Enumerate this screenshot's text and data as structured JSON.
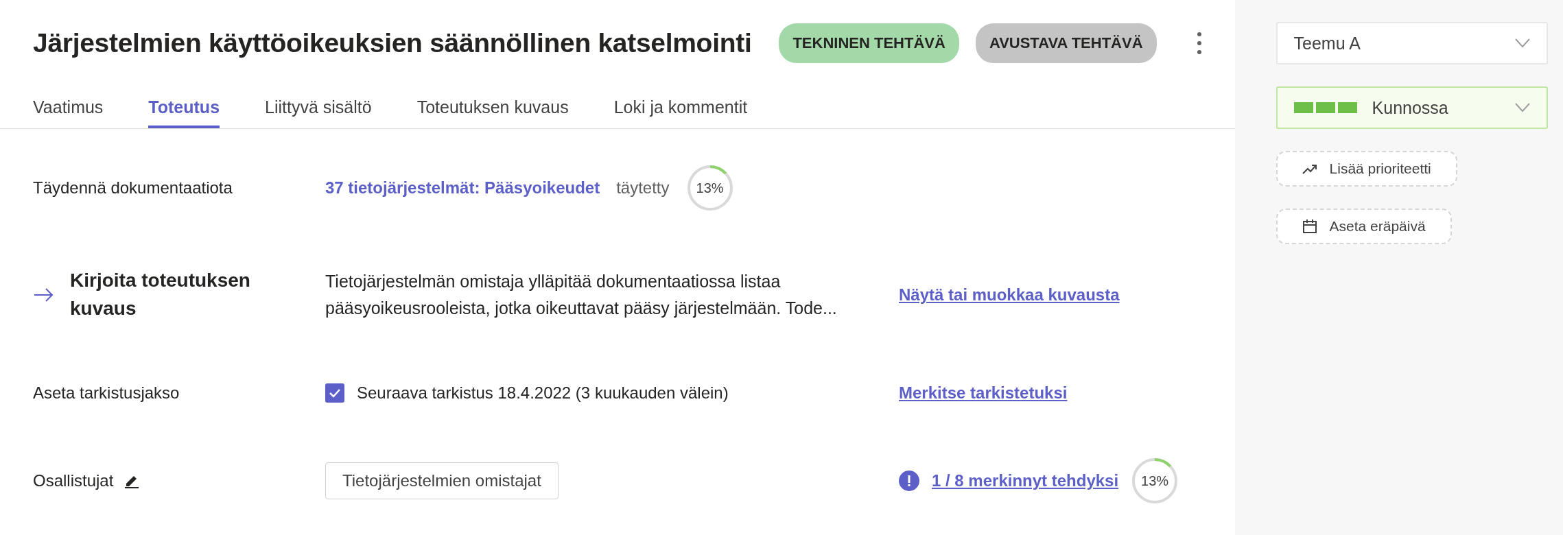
{
  "header": {
    "title": "Järjestelmien käyttöoikeuksien säännöllinen katselmointi",
    "tags": [
      {
        "label": "TEKNINEN TEHTÄVÄ",
        "color": "#a3d9a8"
      },
      {
        "label": "AVUSTAVA TEHTÄVÄ",
        "color": "#c4c4c4"
      }
    ]
  },
  "tabs": [
    {
      "label": "Vaatimus",
      "selected": false
    },
    {
      "label": "Toteutus",
      "selected": true
    },
    {
      "label": "Liittyvä sisältö",
      "selected": false
    },
    {
      "label": "Toteutuksen kuvaus",
      "selected": false
    },
    {
      "label": "Loki ja kommentit",
      "selected": false
    }
  ],
  "documentation": {
    "label": "Täydennä dokumentaatiota",
    "link": "37 tietojärjestelmät: Pääsyoikeudet",
    "status": "täytetty",
    "progress": {
      "reading": "13%"
    }
  },
  "description": {
    "label": "Kirjoita toteutuksen kuvaus",
    "text": "Tietojärjestelmän omistaja ylläpitää dokumentaatiossa listaa pääsyoikeusrooleista, jotka oikeuttavat pääsy järjestelmään. Tode...",
    "link": "Näytä tai muokkaa kuvausta"
  },
  "review": {
    "label": "Aseta tarkistusjakso",
    "checked": true,
    "text": "Seuraava tarkistus 18.4.2022 (3 kuukauden välein)",
    "link": "Merkitse tarkistetuksi"
  },
  "participants": {
    "label": "Osallistujat",
    "group": "Tietojärjestelmien omistajat",
    "link": "1 / 8 merkinnyt tehdyksi",
    "progress": {
      "reading": "13%"
    }
  },
  "sidebar": {
    "assignee": "Teemu A",
    "status": "Kunnossa",
    "buttons": [
      {
        "kind": "priority",
        "label": "Lisää prioriteetti"
      },
      {
        "kind": "date",
        "label": "Aseta eräpäivä"
      }
    ]
  }
}
